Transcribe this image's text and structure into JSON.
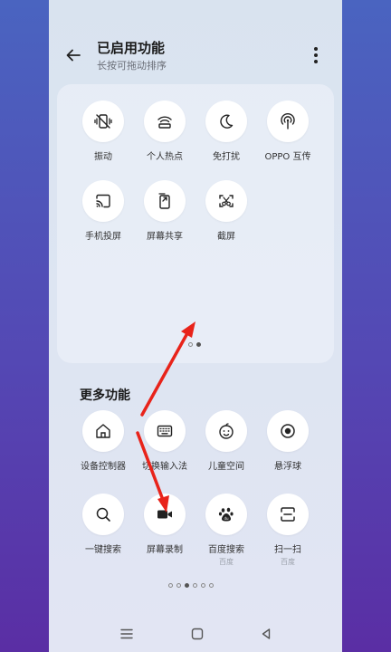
{
  "header": {
    "title": "已启用功能",
    "subtitle": "长按可拖动排序"
  },
  "enabled": {
    "items": [
      {
        "label": "振动",
        "icon": "vibrate-off-icon"
      },
      {
        "label": "个人热点",
        "icon": "hotspot-icon"
      },
      {
        "label": "免打扰",
        "icon": "moon-icon"
      },
      {
        "label": "OPPO 互传",
        "icon": "oppo-share-icon"
      },
      {
        "label": "手机投屏",
        "icon": "screen-cast-icon"
      },
      {
        "label": "屏幕共享",
        "icon": "screen-share-icon"
      },
      {
        "label": "截屏",
        "icon": "screenshot-icon"
      }
    ],
    "page_count": 2,
    "current_page": 2
  },
  "more": {
    "title": "更多功能",
    "items": [
      {
        "label": "设备控制器",
        "icon": "home-icon"
      },
      {
        "label": "切换输入法",
        "icon": "keyboard-icon"
      },
      {
        "label": "儿童空间",
        "icon": "child-face-icon"
      },
      {
        "label": "悬浮球",
        "icon": "floating-ball-icon"
      },
      {
        "label": "一键搜索",
        "icon": "search-icon"
      },
      {
        "label": "屏幕录制",
        "icon": "video-record-icon"
      },
      {
        "label": "百度搜索",
        "sublabel": "百度",
        "icon": "baidu-paw-icon"
      },
      {
        "label": "扫一扫",
        "sublabel": "百度",
        "icon": "scan-icon"
      }
    ],
    "page_count": 6,
    "current_page": 3
  },
  "navbar": {
    "menu": "menu-icon",
    "home": "home-square-icon",
    "back": "back-triangle-icon"
  },
  "colors": {
    "annotation_arrow": "#e8231a",
    "background_top": "#4a64c0",
    "background_bottom": "#5a2ea4"
  }
}
